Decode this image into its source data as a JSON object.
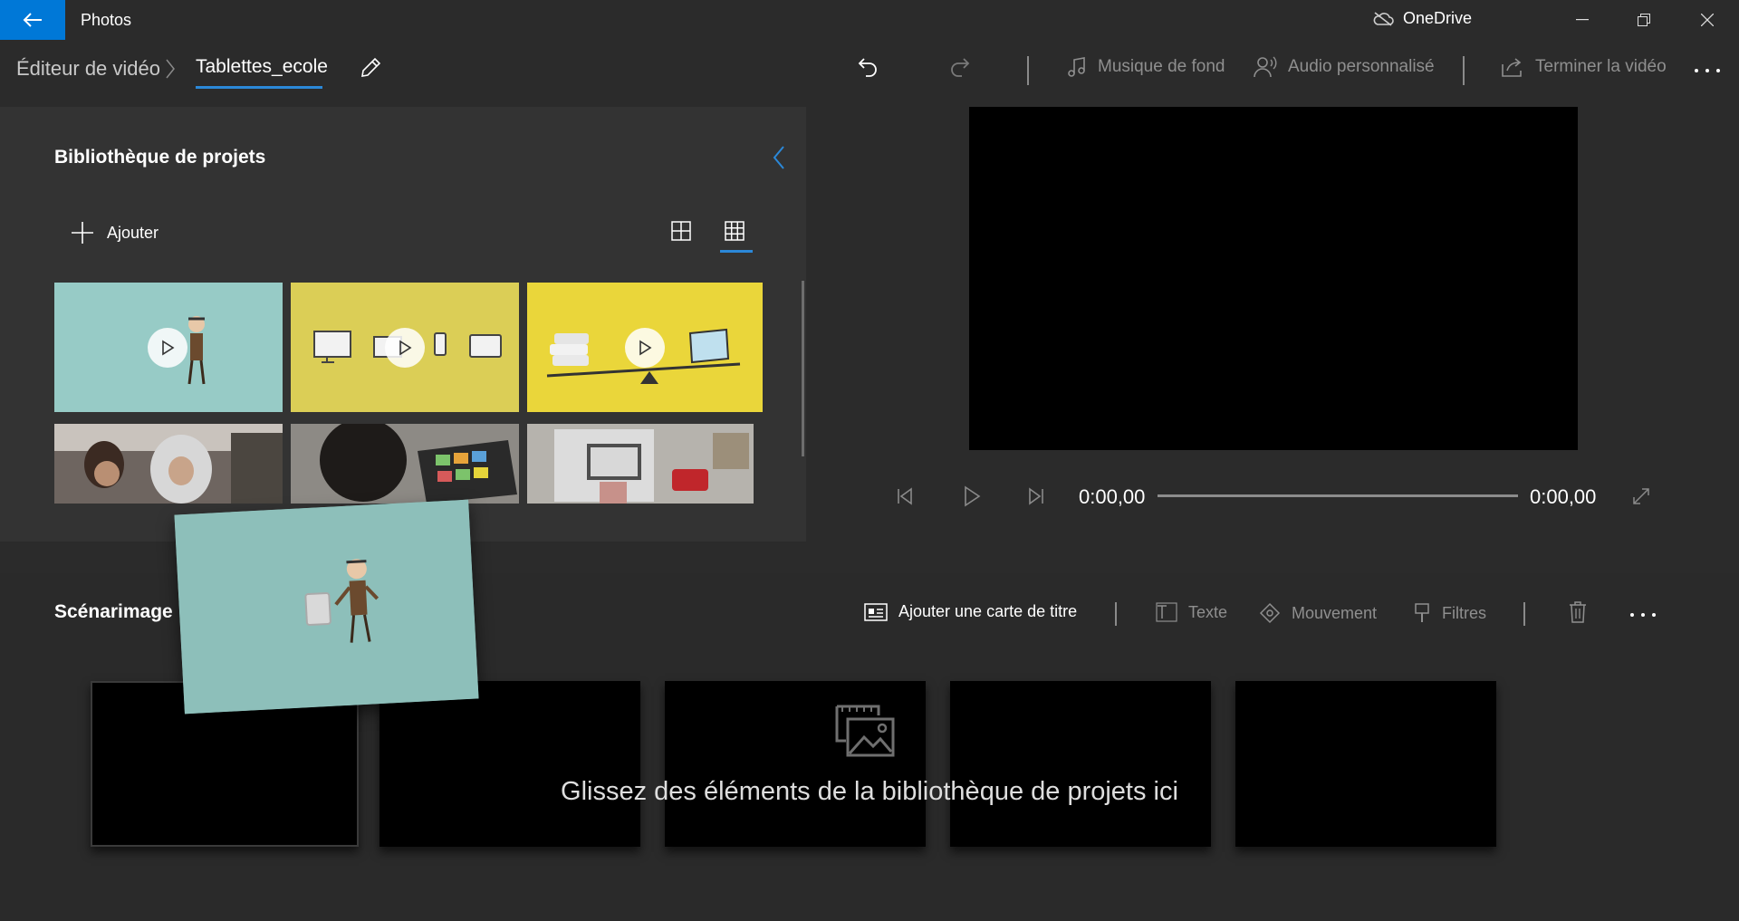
{
  "window": {
    "app_title": "Photos",
    "onedrive_label": "OneDrive"
  },
  "toolbar": {
    "breadcrumb_root": "Éditeur de vidéo",
    "project_name": "Tablettes_ecole",
    "background_music": "Musique de fond",
    "custom_audio": "Audio personnalisé",
    "finish_video": "Terminer la vidéo"
  },
  "library": {
    "title": "Bibliothèque de projets",
    "add_label": "Ajouter",
    "items": [
      {
        "kind": "video",
        "color": "#97cbc6",
        "subject": "cartoon teacher character"
      },
      {
        "kind": "video",
        "color": "#dbce56",
        "subject": "computer devices icons"
      },
      {
        "kind": "video",
        "color": "#ead63a",
        "subject": "balance scale with books and tablet"
      },
      {
        "kind": "image",
        "color": "#7a6d66",
        "subject": "students in classroom"
      },
      {
        "kind": "image",
        "color": "#5a5a55",
        "subject": "student using tablet"
      },
      {
        "kind": "image",
        "color": "#a9a7a2",
        "subject": "tablet and phone on desk"
      }
    ]
  },
  "player": {
    "current_time": "0:00,00",
    "total_time": "0:00,00",
    "progress": 0
  },
  "storyboard": {
    "title": "Scénarimage",
    "add_title_card": "Ajouter une carte de titre",
    "text_label": "Texte",
    "motion_label": "Mouvement",
    "filters_label": "Filtres",
    "drop_hint": "Glissez des éléments de la bibliothèque de projets ici"
  },
  "colors": {
    "accent": "#0078d7",
    "panel": "#333333",
    "background": "#2b2b2b"
  }
}
